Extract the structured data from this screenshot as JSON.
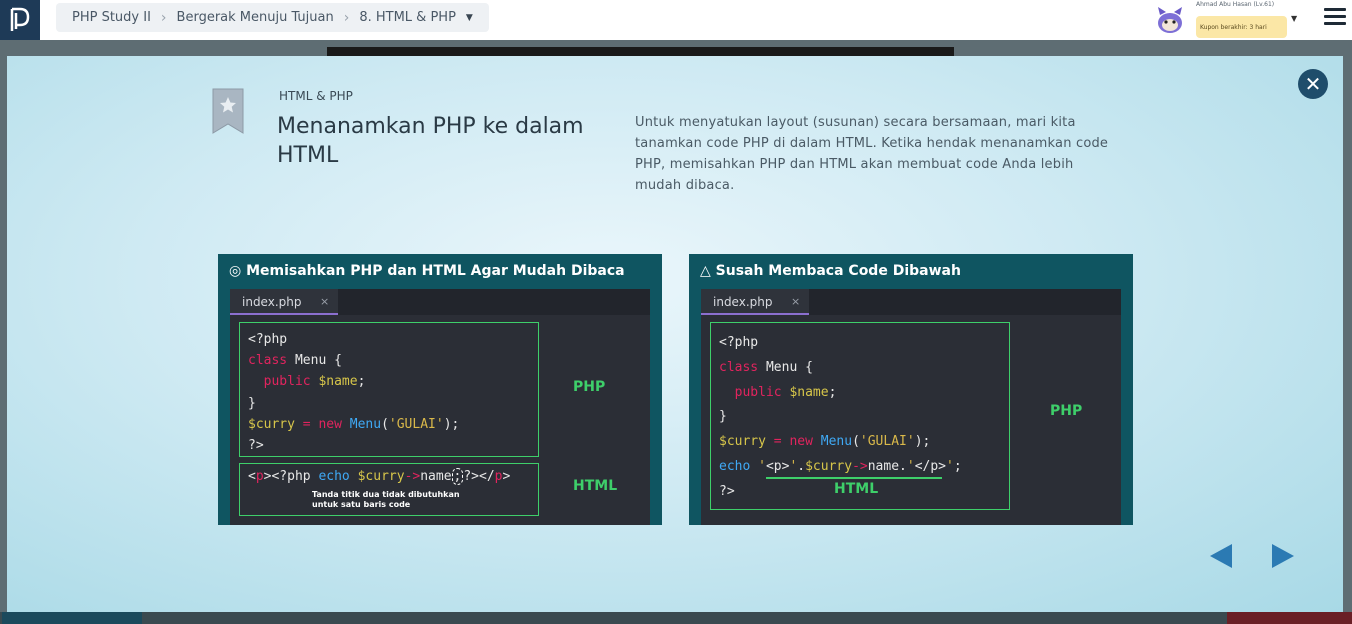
{
  "header": {
    "breadcrumb": [
      "PHP Study II",
      "Bergerak Menuju Tujuan",
      "8. HTML & PHP"
    ],
    "user_name": "Ahmad Abu Hasan (Lv.61)",
    "coupon": "Kupon berakhir: 3 hari"
  },
  "modal": {
    "section_label": "HTML & PHP",
    "title": "Menanamkan PHP ke dalam HTML",
    "description": "Untuk menyatukan layout (susunan) secara bersamaan, mari kita tanamkan code PHP di dalam HTML. Ketika hendak menanamkan code PHP, memisahkan PHP dan HTML akan membuat code Anda lebih mudah dibaca."
  },
  "panels": [
    {
      "title": "◎ Memisahkan PHP dan HTML Agar Mudah Dibaca",
      "tab": "index.php",
      "php_label": "PHP",
      "html_label": "HTML",
      "note": "Tanda titik dua tidak dibutuhkan\nuntuk satu baris code"
    },
    {
      "title": "△ Susah Membaca Code Dibawah",
      "tab": "index.php",
      "php_label": "PHP",
      "html_label": "HTML"
    }
  ],
  "colors": {
    "accent": "#2b7ab3",
    "panel_bg": "#0f5561",
    "code_green": "#3ecf6a",
    "editor_bg": "#2b2e36"
  }
}
